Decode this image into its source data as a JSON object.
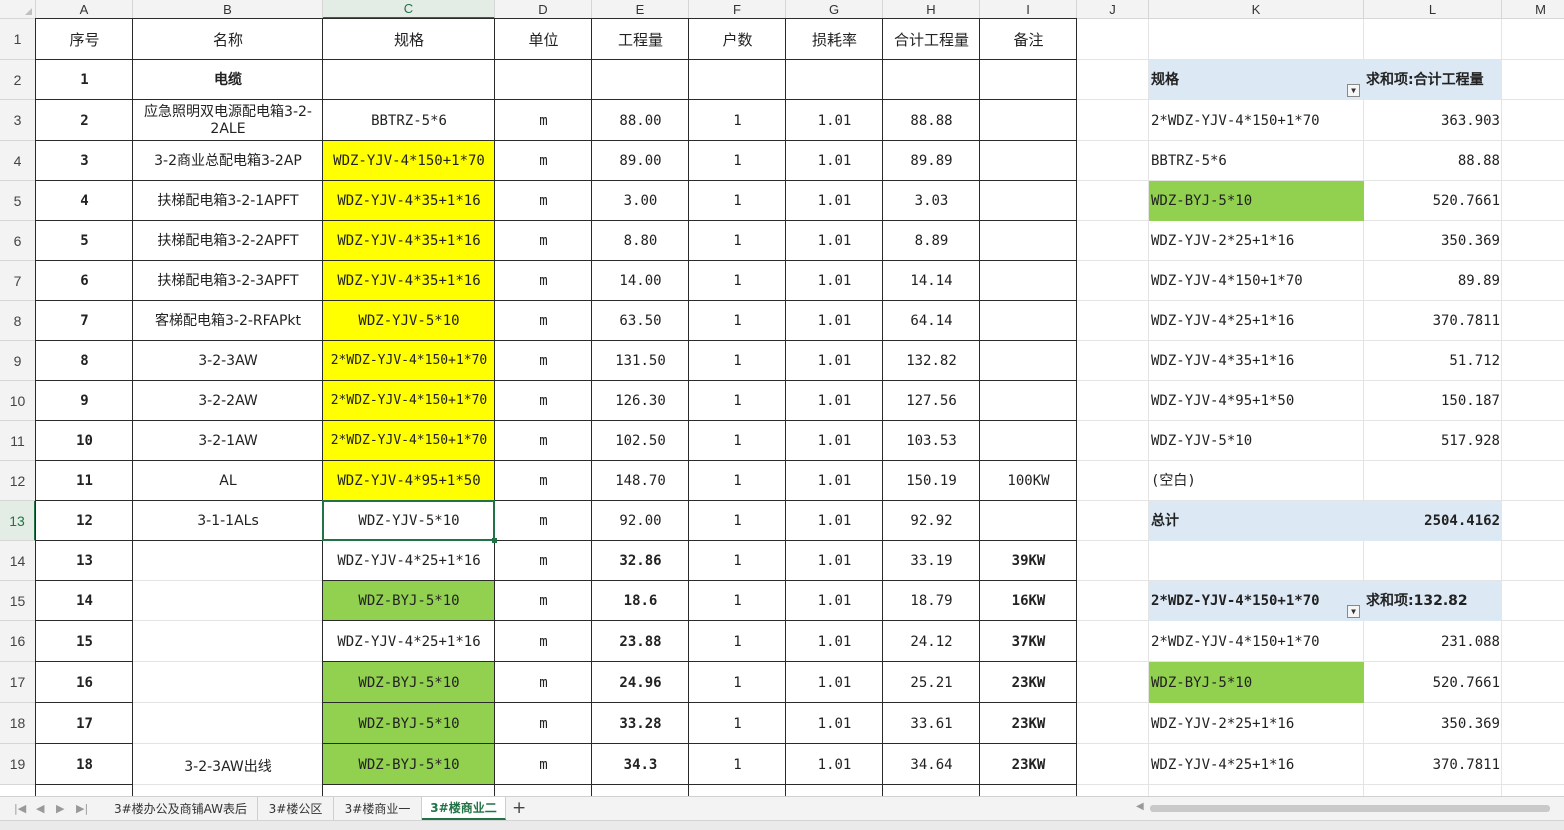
{
  "columns": [
    "A",
    "B",
    "C",
    "D",
    "E",
    "F",
    "G",
    "H",
    "I",
    "J",
    "K",
    "L",
    "M"
  ],
  "selected_column": "C",
  "selected_row": 13,
  "rows": [
    {
      "n": 1,
      "A": "序号",
      "B": "名称",
      "C": "规格",
      "D": "单位",
      "E": "工程量",
      "F": "户数",
      "G": "损耗率",
      "H": "合计工程量",
      "I": "备注"
    },
    {
      "n": 2,
      "A": "1",
      "B": "电缆",
      "C": "",
      "D": "",
      "E": "",
      "F": "",
      "G": "",
      "H": "",
      "I": ""
    },
    {
      "n": 3,
      "A": "2",
      "B": "应急照明双电源配电箱3-2-2ALE",
      "C": "BBTRZ-5*6",
      "D": "m",
      "E": "88.00",
      "F": "1",
      "G": "1.01",
      "H": "88.88",
      "I": ""
    },
    {
      "n": 4,
      "A": "3",
      "B": "3-2商业总配电箱3-2AP",
      "C": "WDZ-YJV-4*150+1*70",
      "D": "m",
      "E": "89.00",
      "F": "1",
      "G": "1.01",
      "H": "89.89",
      "I": ""
    },
    {
      "n": 5,
      "A": "4",
      "B": "扶梯配电箱3-2-1APFT",
      "C": "WDZ-YJV-4*35+1*16",
      "D": "m",
      "E": "3.00",
      "F": "1",
      "G": "1.01",
      "H": "3.03",
      "I": ""
    },
    {
      "n": 6,
      "A": "5",
      "B": "扶梯配电箱3-2-2APFT",
      "C": "WDZ-YJV-4*35+1*16",
      "D": "m",
      "E": "8.80",
      "F": "1",
      "G": "1.01",
      "H": "8.89",
      "I": ""
    },
    {
      "n": 7,
      "A": "6",
      "B": "扶梯配电箱3-2-3APFT",
      "C": "WDZ-YJV-4*35+1*16",
      "D": "m",
      "E": "14.00",
      "F": "1",
      "G": "1.01",
      "H": "14.14",
      "I": ""
    },
    {
      "n": 8,
      "A": "7",
      "B": "客梯配电箱3-2-RFAPkt",
      "C": "WDZ-YJV-5*10",
      "D": "m",
      "E": "63.50",
      "F": "1",
      "G": "1.01",
      "H": "64.14",
      "I": ""
    },
    {
      "n": 9,
      "A": "8",
      "B": "3-2-3AW",
      "C": "2*WDZ-YJV-4*150+1*70",
      "D": "m",
      "E": "131.50",
      "F": "1",
      "G": "1.01",
      "H": "132.82",
      "I": ""
    },
    {
      "n": 10,
      "A": "9",
      "B": "3-2-2AW",
      "C": "2*WDZ-YJV-4*150+1*70",
      "D": "m",
      "E": "126.30",
      "F": "1",
      "G": "1.01",
      "H": "127.56",
      "I": ""
    },
    {
      "n": 11,
      "A": "10",
      "B": "3-2-1AW",
      "C": "2*WDZ-YJV-4*150+1*70",
      "D": "m",
      "E": "102.50",
      "F": "1",
      "G": "1.01",
      "H": "103.53",
      "I": ""
    },
    {
      "n": 12,
      "A": "11",
      "B": "AL",
      "C": "WDZ-YJV-4*95+1*50",
      "D": "m",
      "E": "148.70",
      "F": "1",
      "G": "1.01",
      "H": "150.19",
      "I": "100KW"
    },
    {
      "n": 13,
      "A": "12",
      "B": "3-1-1ALs",
      "C": "WDZ-YJV-5*10",
      "D": "m",
      "E": "92.00",
      "F": "1",
      "G": "1.01",
      "H": "92.92",
      "I": ""
    },
    {
      "n": 14,
      "A": "13",
      "B": "",
      "C": "WDZ-YJV-4*25+1*16",
      "D": "m",
      "E": "32.86",
      "F": "1",
      "G": "1.01",
      "H": "33.19",
      "I": "39KW"
    },
    {
      "n": 15,
      "A": "14",
      "B": "",
      "C": "WDZ-BYJ-5*10",
      "D": "m",
      "E": "18.6",
      "F": "1",
      "G": "1.01",
      "H": "18.79",
      "I": "16KW"
    },
    {
      "n": 16,
      "A": "15",
      "B": "",
      "C": "WDZ-YJV-4*25+1*16",
      "D": "m",
      "E": "23.88",
      "F": "1",
      "G": "1.01",
      "H": "24.12",
      "I": "37KW"
    },
    {
      "n": 17,
      "A": "16",
      "B": "",
      "C": "WDZ-BYJ-5*10",
      "D": "m",
      "E": "24.96",
      "F": "1",
      "G": "1.01",
      "H": "25.21",
      "I": "23KW"
    },
    {
      "n": 18,
      "A": "17",
      "B": "",
      "C": "WDZ-BYJ-5*10",
      "D": "m",
      "E": "33.28",
      "F": "1",
      "G": "1.01",
      "H": "33.61",
      "I": "23KW"
    },
    {
      "n": 19,
      "A": "18",
      "B": "3-2-3AW出线",
      "C": "WDZ-BYJ-5*10",
      "D": "m",
      "E": "34.3",
      "F": "1",
      "G": "1.01",
      "H": "34.64",
      "I": "23KW"
    }
  ],
  "pivot1": {
    "header_spec": "规格",
    "header_sum": "求和项:合计工程量",
    "items": [
      {
        "spec": "2*WDZ-YJV-4*150+1*70",
        "value": "363.903"
      },
      {
        "spec": "BBTRZ-5*6",
        "value": "88.88"
      },
      {
        "spec": "WDZ-BYJ-5*10",
        "value": "520.7661"
      },
      {
        "spec": "WDZ-YJV-2*25+1*16",
        "value": "350.369"
      },
      {
        "spec": "WDZ-YJV-4*150+1*70",
        "value": "89.89"
      },
      {
        "spec": "WDZ-YJV-4*25+1*16",
        "value": "370.7811"
      },
      {
        "spec": "WDZ-YJV-4*35+1*16",
        "value": "51.712"
      },
      {
        "spec": "WDZ-YJV-4*95+1*50",
        "value": "150.187"
      },
      {
        "spec": "WDZ-YJV-5*10",
        "value": "517.928"
      },
      {
        "spec": "(空白)",
        "value": ""
      }
    ],
    "total_label": "总计",
    "total_value": "2504.4162"
  },
  "pivot2": {
    "header_spec": "2*WDZ-YJV-4*150+1*70",
    "header_sum": "求和项:132.82",
    "items": [
      {
        "spec": "2*WDZ-YJV-4*150+1*70",
        "value": "231.088"
      },
      {
        "spec": "WDZ-BYJ-5*10",
        "value": "520.7661"
      },
      {
        "spec": "WDZ-YJV-2*25+1*16",
        "value": "350.369"
      },
      {
        "spec": "WDZ-YJV-4*25+1*16",
        "value": "370.7811"
      }
    ]
  },
  "sheet_tabs": [
    "3#楼办公及商铺AW表后",
    "3#楼公区",
    "3#楼商业一",
    "3#楼商业二"
  ],
  "active_tab": "3#楼商业二",
  "colors": {
    "yellow": "#ffff00",
    "green": "#92d050",
    "pivot_header": "#dce9f5",
    "selection": "#217346"
  }
}
